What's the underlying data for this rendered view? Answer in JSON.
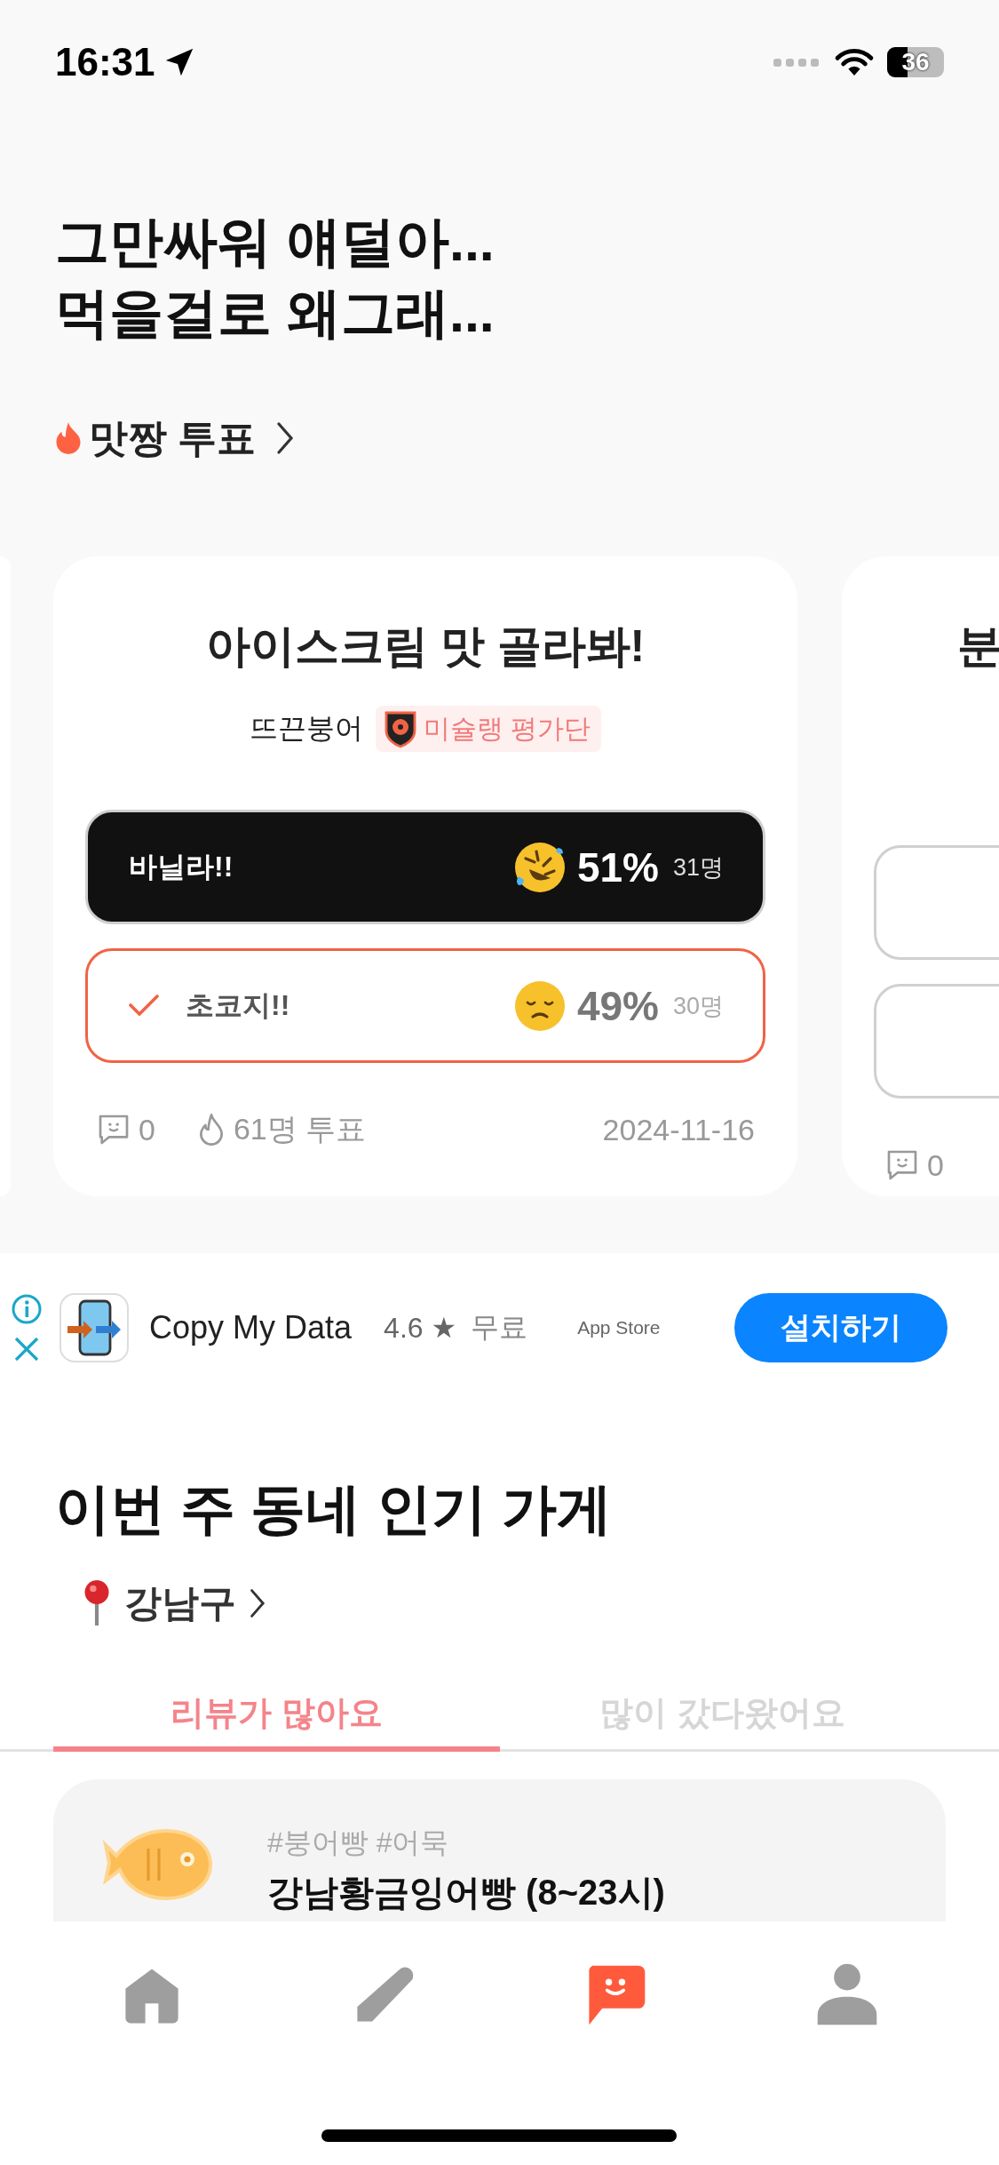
{
  "status_bar": {
    "time": "16:31",
    "battery": "36"
  },
  "headline": [
    "그만싸워 얘덜아...",
    "먹을걸로 왜그래..."
  ],
  "vote_section": {
    "title": "맛짱 투표"
  },
  "vote_cards": [
    {
      "title": "아이스크림 맛 골라봐!",
      "author": "뜨끈붕어",
      "badge": "미슐랭 평가단",
      "options": [
        {
          "kind": "laughing",
          "label": "바닐라!!",
          "percent": "51%",
          "count": "31명",
          "leading": true,
          "selected": false
        },
        {
          "kind": "sad",
          "label": "초코지!!",
          "percent": "49%",
          "count": "30명",
          "leading": false,
          "selected": true
        }
      ],
      "comments": "0",
      "votes": "61명 투표",
      "date": "2024-11-16"
    },
    {
      "title": "분",
      "options": [
        {
          "kind": "blank"
        },
        {
          "kind": "blank"
        }
      ],
      "comments": "0"
    }
  ],
  "ad": {
    "app_name": "Copy My Data",
    "rating": "4.6 ★",
    "price": "무료",
    "store": "App Store",
    "button": "설치하기"
  },
  "popular": {
    "title": "이번 주 동네 인기 가게",
    "location": "강남구",
    "tabs": [
      {
        "label": "리뷰가 많아요",
        "selected": true
      },
      {
        "label": "많이 갔다왔어요",
        "selected": false
      }
    ],
    "stores": [
      {
        "tags": "#붕어빵 #어묵",
        "name": "강남황금잉어빵 (8~23시)"
      }
    ]
  },
  "bottom_nav": [
    {
      "kind": "home",
      "selected": false
    },
    {
      "kind": "write",
      "selected": false
    },
    {
      "kind": "chat",
      "selected": true
    },
    {
      "kind": "profile",
      "selected": false
    }
  ]
}
